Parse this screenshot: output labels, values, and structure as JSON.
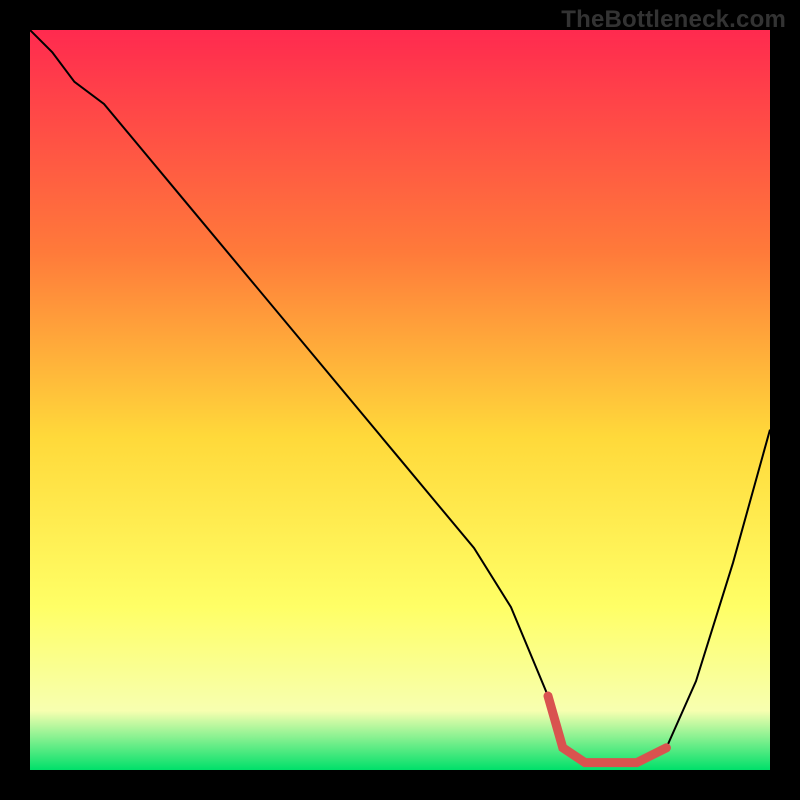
{
  "watermark": "TheBottleneck.com",
  "colors": {
    "bg_black": "#000000",
    "grad_top": "#ff2a4f",
    "grad_mid1": "#ff7a3a",
    "grad_mid2": "#ffd93a",
    "grad_yellow": "#ffff66",
    "grad_pale": "#f7ffb0",
    "grad_green": "#00e06a",
    "curve": "#000000",
    "thick_red": "#d9534f"
  },
  "chart_data": {
    "type": "line",
    "title": "",
    "xlabel": "",
    "ylabel": "",
    "xlim": [
      0,
      100
    ],
    "ylim": [
      0,
      100
    ],
    "series": [
      {
        "name": "bottleneck-curve",
        "x": [
          0,
          3,
          6,
          10,
          15,
          20,
          30,
          40,
          50,
          55,
          60,
          65,
          70,
          72,
          75,
          78,
          82,
          86,
          90,
          95,
          100
        ],
        "y": [
          100,
          97,
          93,
          90,
          84,
          78,
          66,
          54,
          42,
          36,
          30,
          22,
          10,
          3,
          1,
          1,
          1,
          3,
          12,
          28,
          46
        ]
      }
    ],
    "annotations": [
      {
        "name": "optimal-range",
        "x_start": 70,
        "x_end": 86,
        "y": 1
      }
    ]
  }
}
